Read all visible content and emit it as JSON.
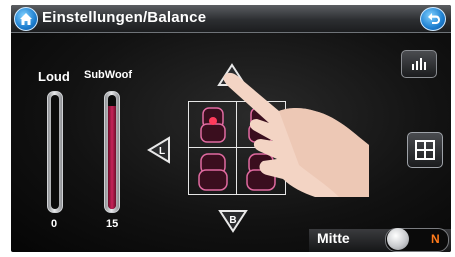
{
  "header": {
    "title": "Einstellungen/Balance"
  },
  "sliders": [
    {
      "label": "Loud",
      "value_label": "0",
      "level": 0.0
    },
    {
      "label": "SubWoof",
      "value_label": "15",
      "level": 0.9
    }
  ],
  "arrows": {
    "front": "F",
    "back": "B",
    "left": "L"
  },
  "mode": {
    "label": "Mitte",
    "toggle_value": "N"
  },
  "colors": {
    "accent": "#c7245a",
    "toggle_text": "#ff7a1a",
    "seat_outline": "#e06aa0"
  }
}
